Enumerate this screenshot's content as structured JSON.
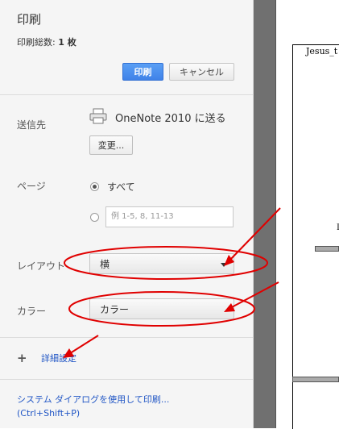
{
  "header": {
    "title": "印刷",
    "total_label": "印刷総数:",
    "total_value": "1 枚",
    "print_button": "印刷",
    "cancel_button": "キャンセル"
  },
  "destination": {
    "label": "送信先",
    "name": "OneNote 2010 に送る",
    "change_button": "変更..."
  },
  "pages": {
    "label": "ページ",
    "all_label": "すべて",
    "range_placeholder": "例 1-5, 8, 11-13"
  },
  "layout": {
    "label": "レイアウト",
    "value": "横"
  },
  "color": {
    "label": "カラー",
    "value": "カラー"
  },
  "advanced": {
    "label": "詳細設定"
  },
  "system_dialog": {
    "label": "システム ダイアログを使用して印刷...",
    "shortcut": "(Ctrl+Shift+P)"
  },
  "preview": {
    "page_text": "Jesus_t",
    "mark": "L"
  },
  "annotation_color": "#e00000"
}
